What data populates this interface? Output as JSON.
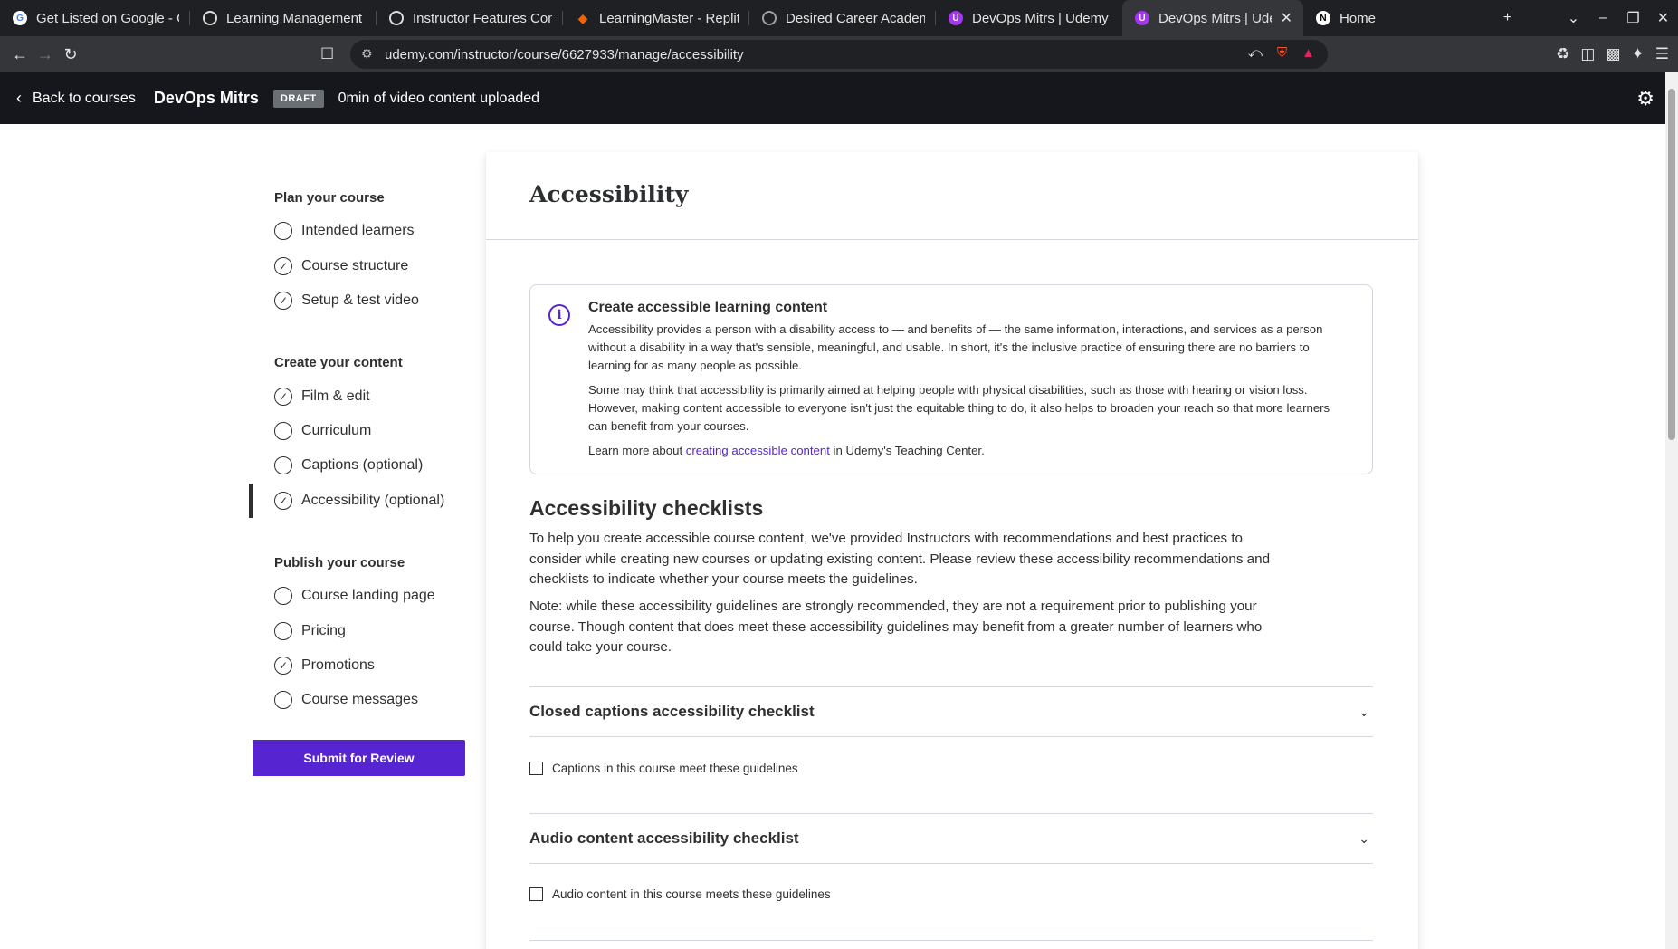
{
  "browser": {
    "tabs": [
      {
        "title": "Get Listed on Google - G",
        "icon": "google-icon",
        "color": "#ffffff",
        "active": false
      },
      {
        "title": "Learning Management",
        "icon": "chatgpt-icon",
        "color": "#ffffff",
        "active": false
      },
      {
        "title": "Instructor Features Com",
        "icon": "chatgpt-icon",
        "color": "#ffffff",
        "active": false
      },
      {
        "title": "LearningMaster - Replit",
        "icon": "replit-icon",
        "color": "#f26207",
        "active": false
      },
      {
        "title": "Desired Career Academ",
        "icon": "globe-icon",
        "color": "#9aa0a6",
        "active": false
      },
      {
        "title": "DevOps Mitrs | Udemy",
        "icon": "udemy-icon",
        "color": "#a435f0",
        "active": false
      },
      {
        "title": "DevOps Mitrs | Udem",
        "icon": "udemy-icon",
        "color": "#a435f0",
        "active": true
      },
      {
        "title": "Home",
        "icon": "notion-icon",
        "color": "#ffffff",
        "active": false
      }
    ],
    "url": "udemy.com/instructor/course/6627933/manage/accessibility"
  },
  "header": {
    "back_label": "Back to courses",
    "course_title": "DevOps Mitrs",
    "badge": "DRAFT",
    "video_status": "0min of video content uploaded"
  },
  "sidebar": {
    "groups": [
      {
        "title": "Plan your course",
        "items": [
          {
            "label": "Intended learners",
            "done": false
          },
          {
            "label": "Course structure",
            "done": true
          },
          {
            "label": "Setup & test video",
            "done": true
          }
        ]
      },
      {
        "title": "Create your content",
        "items": [
          {
            "label": "Film & edit",
            "done": true
          },
          {
            "label": "Curriculum",
            "done": false
          },
          {
            "label": "Captions (optional)",
            "done": false
          },
          {
            "label": "Accessibility (optional)",
            "done": true,
            "active": true
          }
        ]
      },
      {
        "title": "Publish your course",
        "items": [
          {
            "label": "Course landing page",
            "done": false
          },
          {
            "label": "Pricing",
            "done": false
          },
          {
            "label": "Promotions",
            "done": true
          },
          {
            "label": "Course messages",
            "done": false
          }
        ]
      }
    ],
    "submit_label": "Submit for Review"
  },
  "main": {
    "title": "Accessibility",
    "info": {
      "title": "Create accessible learning content",
      "p1": "Accessibility provides a person with a disability access to — and benefits of — the same information, interactions, and services as a person without a disability in a way that's sensible, meaningful, and usable. In short, it's the inclusive practice of ensuring there are no barriers to learning for as many people as possible.",
      "p2": "Some may think that accessibility is primarily aimed at helping people with physical disabilities, such as those with hearing or vision loss. However, making content accessible to everyone isn't just the equitable thing to do, it also helps to broaden your reach so that more learners can benefit from your courses.",
      "learn_prefix": "Learn more about ",
      "learn_link": "creating accessible content",
      "learn_suffix": " in Udemy's Teaching Center."
    },
    "checklists_title": "Accessibility checklists",
    "checklists_p1": "To help you create accessible course content, we've provided Instructors with recommendations and best practices to consider while creating new courses or updating existing content. Please review these accessibility recommendations and checklists to indicate whether your course meets the guidelines.",
    "checklists_p2": "Note: while these accessibility guidelines are strongly recommended, they are not a requirement prior to publishing your course. Though content that does meet these accessibility guidelines may benefit from a greater number of learners who could take your course.",
    "accordions": [
      {
        "title": "Closed captions accessibility checklist",
        "checkbox": "Captions in this course meet these guidelines",
        "checked": false
      },
      {
        "title": "Audio content accessibility checklist",
        "checkbox": "Audio content in this course meets these guidelines",
        "checked": false
      }
    ]
  },
  "colors": {
    "brand": "#5624d0",
    "header_bg": "#16161d",
    "text": "#2d2f31"
  }
}
